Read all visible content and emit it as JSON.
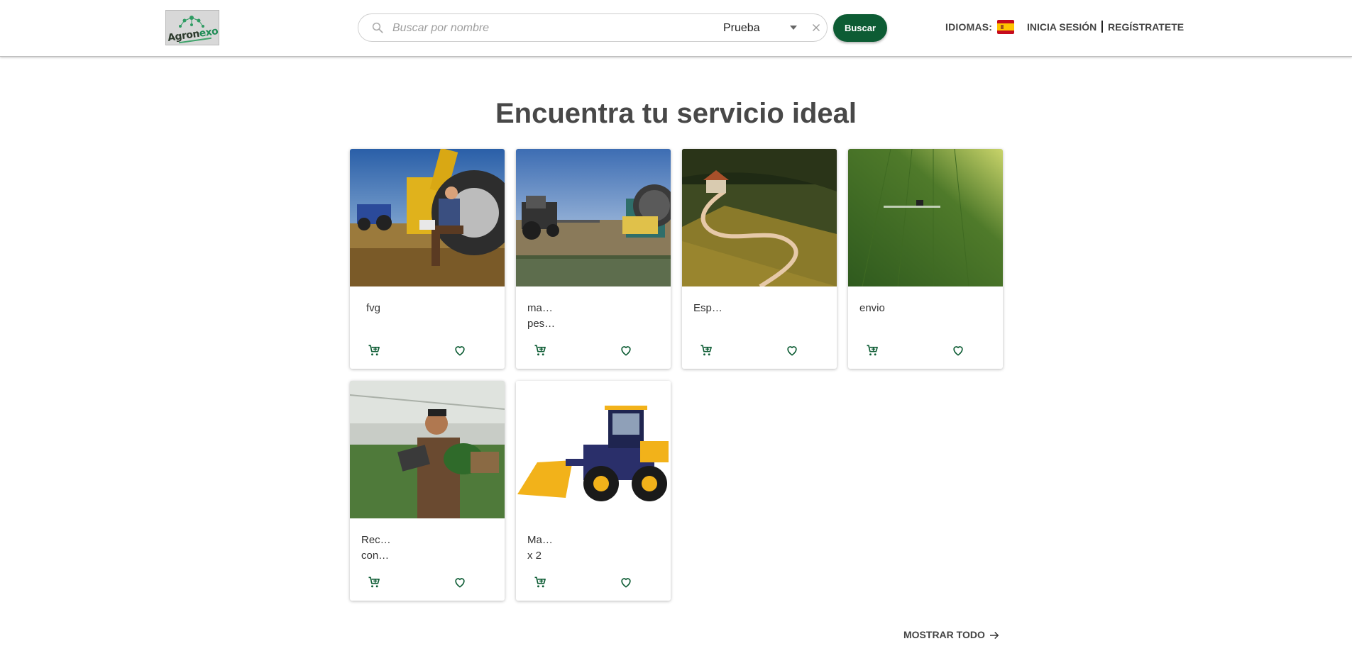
{
  "header": {
    "logo_text_main": "Agron",
    "logo_text_accent": "exo",
    "search": {
      "placeholder": "Buscar por nombre",
      "value": "",
      "category": "Prueba"
    },
    "search_button_label": "Buscar",
    "language_label": "IDIOMAS:",
    "language_flag": "spain-flag",
    "login_label": "INICIA SESIÓN",
    "register_label": "REGÍSTRATETE"
  },
  "main": {
    "title": "Encuentra tu servicio ideal",
    "services": [
      {
        "name_lines": [
          "fvg"
        ],
        "image": "farmer-with-laptop-by-tractor"
      },
      {
        "name_lines": [
          "ma…",
          "pes…"
        ],
        "image": "tractor-and-irrigation-reel"
      },
      {
        "name_lines": [
          "Esp…"
        ],
        "image": "winding-road-vineyard-house"
      },
      {
        "name_lines": [
          "envio"
        ],
        "image": "aerial-green-field-sprayer"
      },
      {
        "name_lines": [
          "Rec…",
          "con…"
        ],
        "image": "greenhouse-worker-with-tablet"
      },
      {
        "name_lines": [
          "Ma…",
          "x 2"
        ],
        "image": "yellow-wheel-loader"
      }
    ],
    "show_all_label": "MOSTRAR TODO"
  },
  "colors": {
    "primary": "#0d5c34",
    "icon": "#0d5c34",
    "title": "#484848"
  }
}
